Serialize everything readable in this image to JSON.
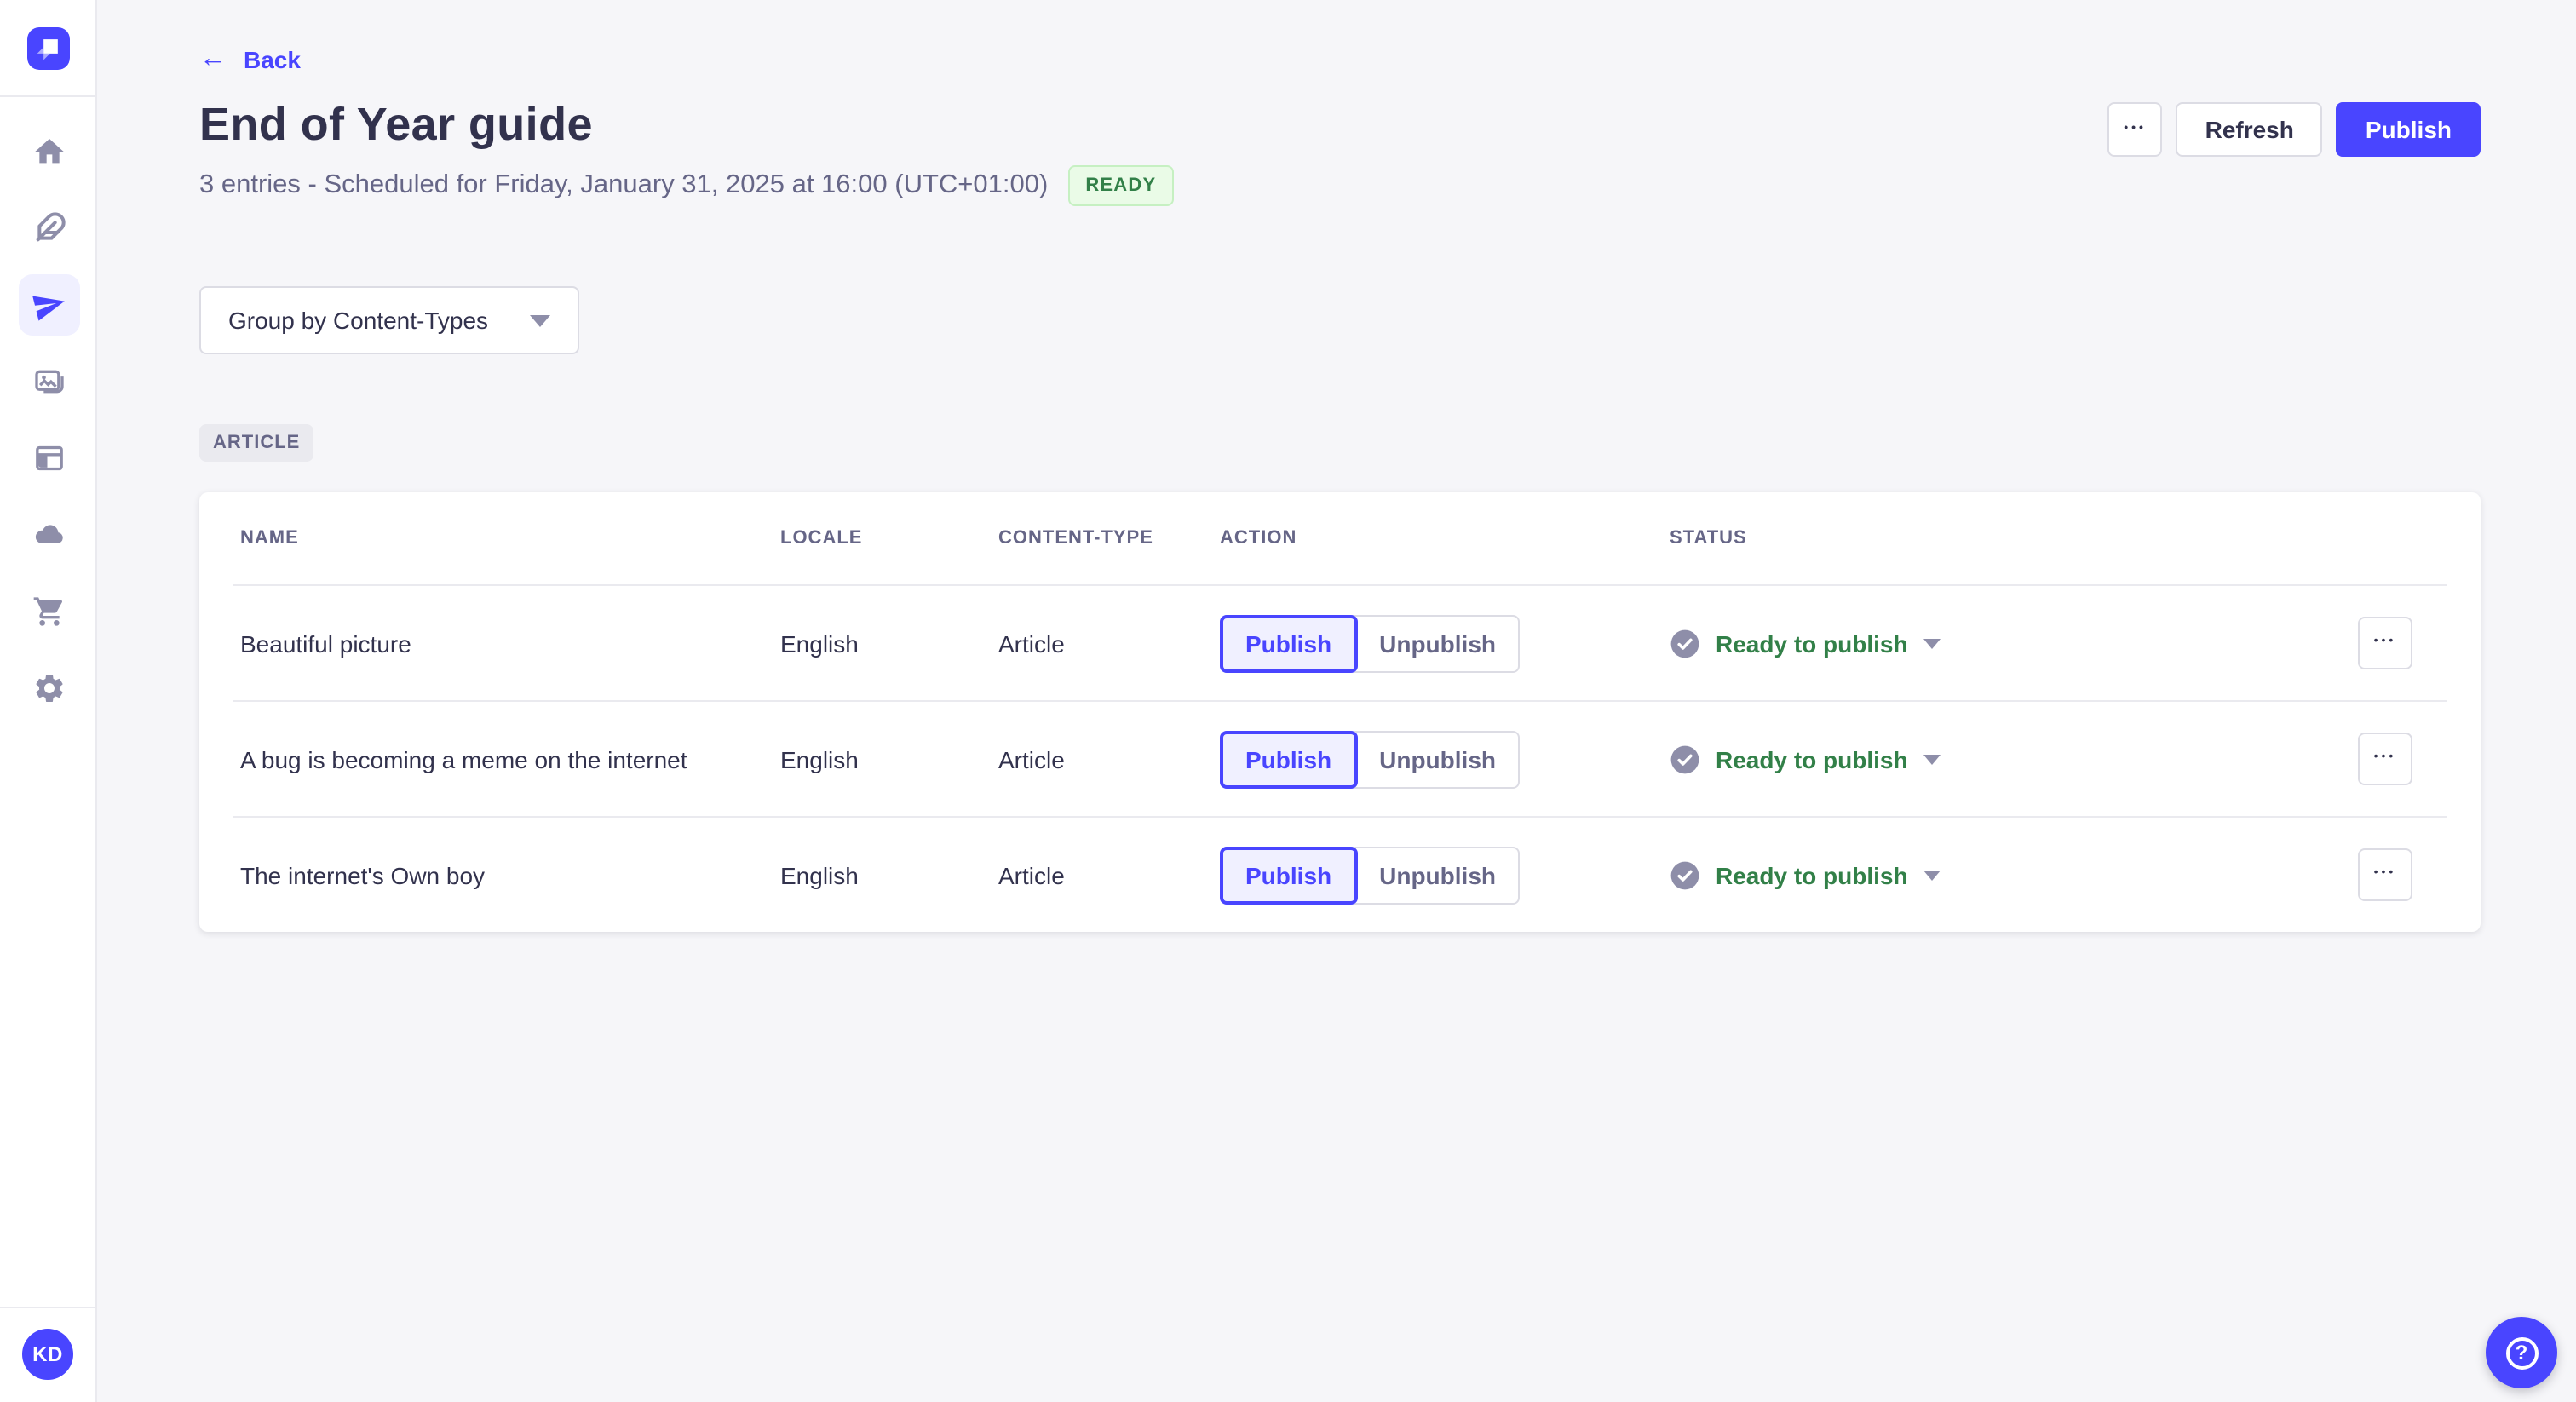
{
  "ui": {
    "ellipsis": "•••",
    "help_glyph": "?"
  },
  "colors": {
    "accent": "#4945FF",
    "accent_light_bg": "#F0F0FF",
    "text_dark": "#32324D",
    "text_gray": "#666687",
    "icon_gray": "#8E8EA9",
    "border": "#DCDCE4",
    "divider": "#EAEAEF",
    "page_bg": "#F6F6F9",
    "success_text": "#328048",
    "success_bg": "#EAFBE7",
    "success_border": "#C6F0C2"
  },
  "sidebar": {
    "items": [
      {
        "id": "home",
        "icon": "home-icon",
        "active": false
      },
      {
        "id": "content-manager",
        "icon": "feather-icon",
        "active": false
      },
      {
        "id": "releases",
        "icon": "paper-plane-icon",
        "active": true
      },
      {
        "id": "media-library",
        "icon": "images-icon",
        "active": false
      },
      {
        "id": "content-type-builder",
        "icon": "layout-icon",
        "active": false
      },
      {
        "id": "cloud",
        "icon": "cloud-icon",
        "active": false
      },
      {
        "id": "marketplace",
        "icon": "cart-icon",
        "active": false
      },
      {
        "id": "settings",
        "icon": "gear-icon",
        "active": false
      }
    ],
    "avatar_initials": "KD"
  },
  "header": {
    "back_label": "Back",
    "title": "End of Year guide",
    "subtitle": "3 entries - Scheduled for Friday, January 31, 2025 at 16:00 (UTC+01:00)",
    "status_badge": "READY",
    "refresh_label": "Refresh",
    "publish_label": "Publish"
  },
  "toolbar": {
    "group_by_label": "Group by Content-Types"
  },
  "group": {
    "badge": "ARTICLE"
  },
  "table": {
    "columns": [
      "NAME",
      "LOCALE",
      "CONTENT-TYPE",
      "ACTION",
      "STATUS"
    ],
    "actions": {
      "publish": "Publish",
      "unpublish": "Unpublish"
    },
    "rows": [
      {
        "name": "Beautiful picture",
        "locale": "English",
        "content_type": "Article",
        "status": "Ready to publish"
      },
      {
        "name": "A bug is becoming a meme on the internet",
        "locale": "English",
        "content_type": "Article",
        "status": "Ready to publish"
      },
      {
        "name": "The internet's Own boy",
        "locale": "English",
        "content_type": "Article",
        "status": "Ready to publish"
      }
    ]
  }
}
